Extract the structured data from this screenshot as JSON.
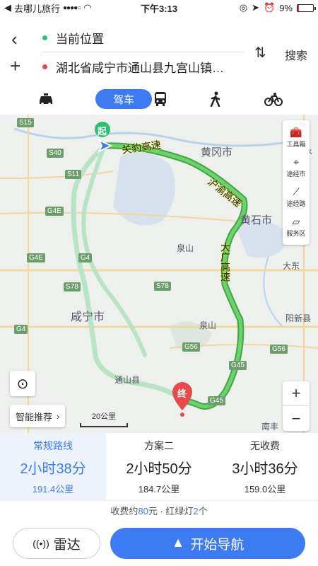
{
  "status_bar": {
    "carrier": "去哪儿旅行",
    "time": "下午3:13",
    "battery": "9%",
    "signal_icon": "signal-dots-icon",
    "wifi_icon": "wifi-icon"
  },
  "route": {
    "origin": "当前位置",
    "destination": "湖北省咸宁市通山县九宫山镇…",
    "search_label": "搜索",
    "origin_color": "#2fbf71",
    "destination_color": "#e84a4a"
  },
  "modes": {
    "active_label": "驾车"
  },
  "map": {
    "start_marker": "起",
    "end_marker": "终",
    "road_labels": [
      "关豹高速",
      "沪渝高速",
      "大广高速"
    ],
    "place_labels": [
      "黄冈市",
      "黄石市",
      "咸宁市",
      "泉山",
      "泉山",
      "大东",
      "阳新县",
      "通山县",
      "南丰",
      "浠水县"
    ],
    "shields": [
      "S15",
      "S40",
      "S11",
      "G4E",
      "G4E",
      "G4",
      "S78",
      "S78",
      "G4",
      "G56",
      "G45",
      "G45",
      "G56"
    ],
    "tools": [
      {
        "label": "工具箱",
        "icon": "toolbox-icon"
      },
      {
        "label": "途经市",
        "icon": "location-pin-icon"
      },
      {
        "label": "途经路",
        "icon": "route-icon"
      },
      {
        "label": "服务区",
        "icon": "map-service-icon"
      }
    ],
    "smart_label": "智能推荐",
    "scale_label": "20公里",
    "zoom_in": "+",
    "zoom_out": "−",
    "route_color": "#5cbb5c"
  },
  "plans": [
    {
      "name": "常规路线",
      "time": "2小时38分",
      "distance": "191.4公里"
    },
    {
      "name": "方案二",
      "time": "2小时50分",
      "distance": "184.7公里"
    },
    {
      "name": "无收费",
      "time": "3小时36分",
      "distance": "159.0公里"
    }
  ],
  "fee": {
    "prefix": "收费约",
    "amount": "80",
    "unit": "元 · 红绿灯",
    "lights": "2",
    "suffix": "个"
  },
  "buttons": {
    "radar": "雷达",
    "navigate": "开始导航"
  },
  "accent_color": "#3d7bf3"
}
